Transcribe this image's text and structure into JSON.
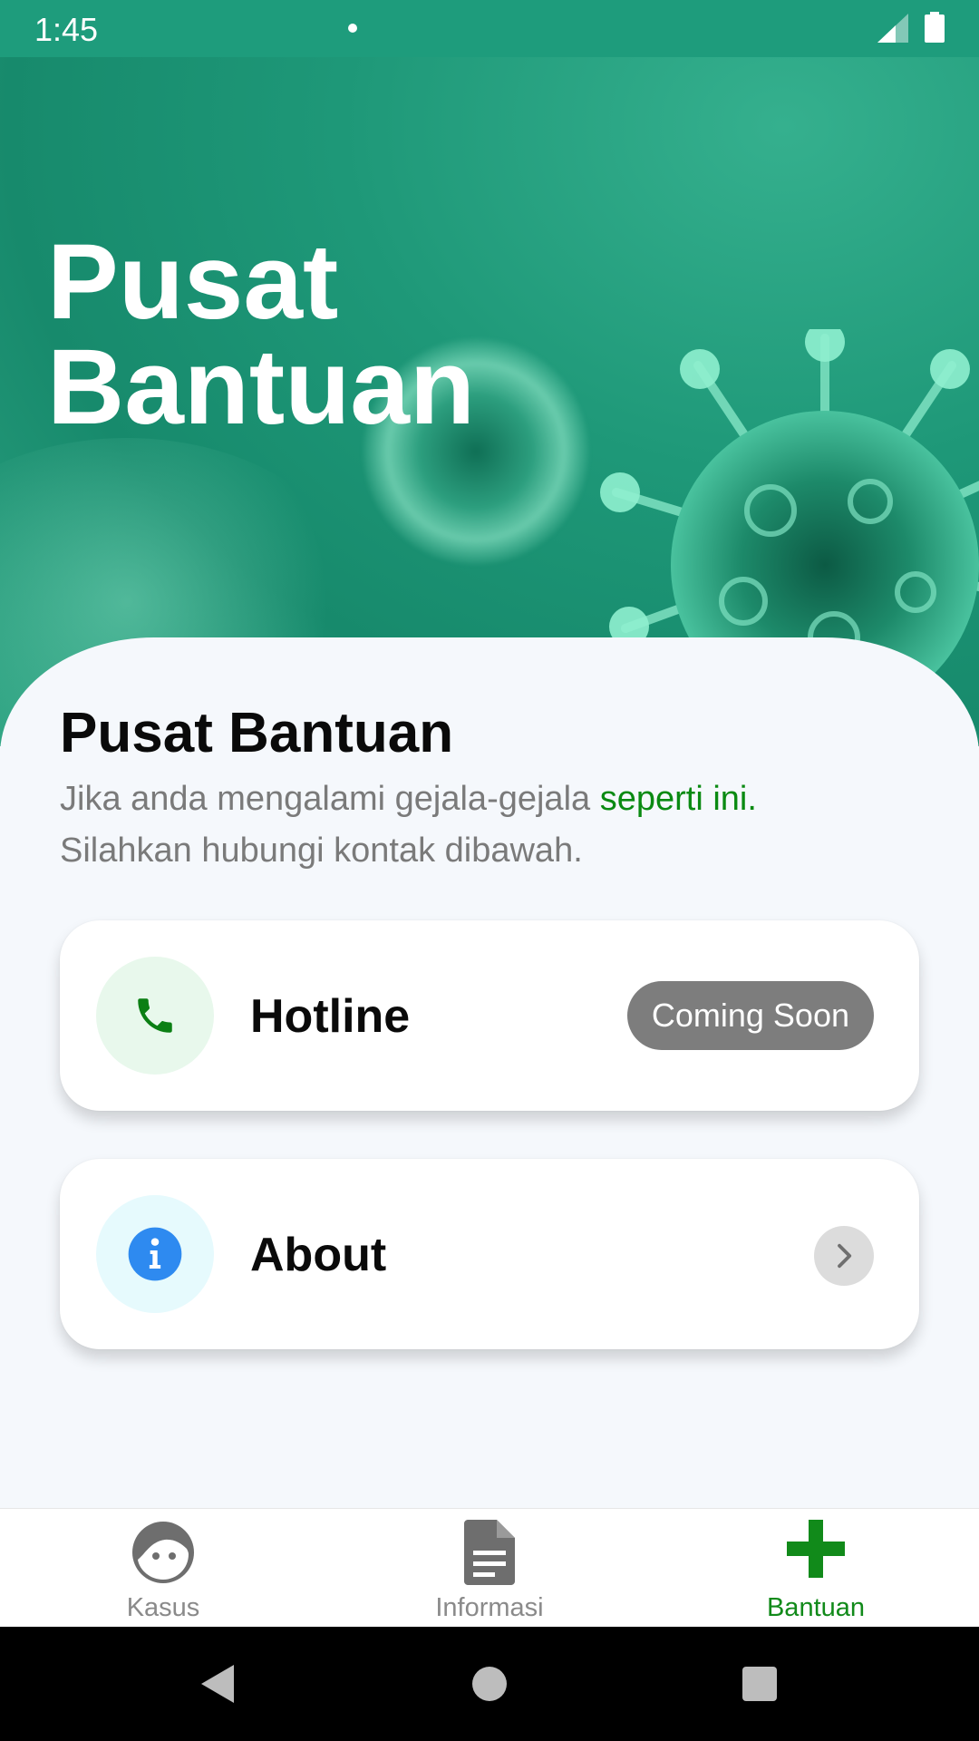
{
  "status_bar": {
    "time": "1:45"
  },
  "hero": {
    "title_line1": "Pusat",
    "title_line2": "Bantuan"
  },
  "section": {
    "title": "Pusat Bantuan",
    "desc_part1": "Jika anda mengalami gejala-gejala ",
    "desc_link": "seperti ini.",
    "desc_part2": "Silahkan hubungi kontak dibawah."
  },
  "cards": {
    "hotline": {
      "label": "Hotline",
      "badge": "Coming Soon",
      "icon": "phone-icon"
    },
    "about": {
      "label": "About",
      "icon": "info-icon",
      "action_icon": "chevron-right-icon"
    }
  },
  "bottom_nav": [
    {
      "label": "Kasus",
      "icon": "face-icon",
      "active": false
    },
    {
      "label": "Informasi",
      "icon": "document-icon",
      "active": false
    },
    {
      "label": "Bantuan",
      "icon": "plus-icon",
      "active": true
    }
  ],
  "colors": {
    "primary": "#1e9c7c",
    "accent_green": "#118a1a",
    "info_blue": "#2e8af0",
    "badge_gray": "#7d7d7d"
  }
}
